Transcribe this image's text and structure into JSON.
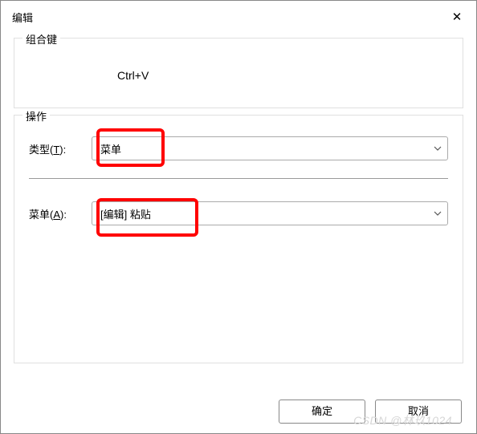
{
  "window": {
    "title": "编辑",
    "close_glyph": "✕"
  },
  "combo": {
    "group_label": "组合键",
    "value": "Ctrl+V"
  },
  "action": {
    "group_label": "操作",
    "type_label": "类型(T):",
    "type_value": "菜单",
    "menu_label": "菜单(A):",
    "menu_value": "[编辑] 粘贴"
  },
  "buttons": {
    "ok": "确定",
    "cancel": "取消"
  },
  "watermark": "CSDN @林玖1024"
}
